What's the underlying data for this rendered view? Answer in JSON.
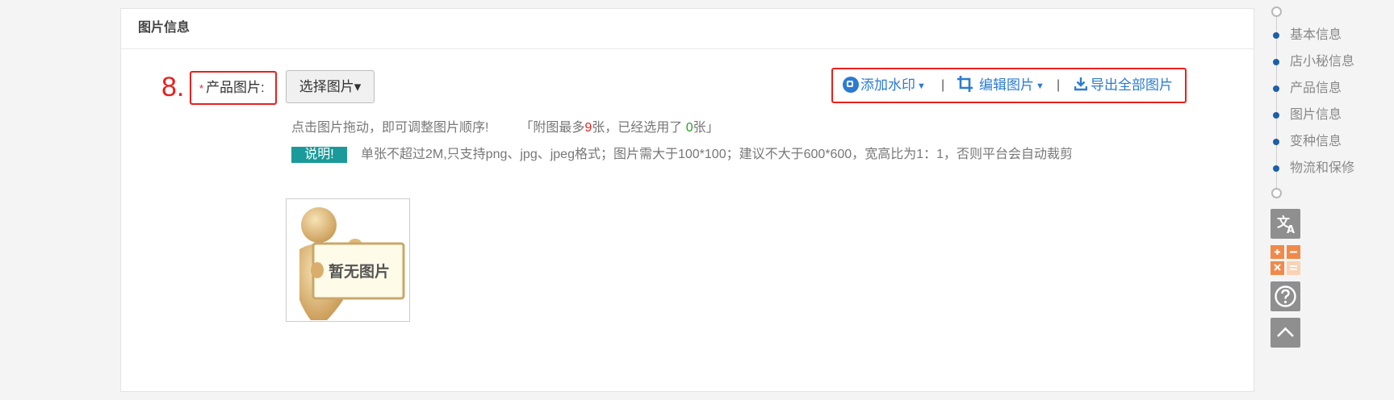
{
  "section": {
    "title": "图片信息"
  },
  "field": {
    "step_number": "8.",
    "required_mark": "*",
    "label": "产品图片:",
    "choose_button": "选择图片▾"
  },
  "toolbar": {
    "watermark_label": "添加水印",
    "edit_label": "编辑图片",
    "export_label": "导出全部图片",
    "separator": "|"
  },
  "hint": {
    "drag_text": "点击图片拖动，即可调整图片顺序!",
    "max_prefix": "「附图最多",
    "max_count": "9",
    "max_middle": "张，已经选用了",
    "selected_count": "0",
    "max_suffix": "张」"
  },
  "note": {
    "badge": "说明!",
    "text": "单张不超过2M,只支持png、jpg、jpeg格式；图片需大于100*100；建议不大于600*600，宽高比为1：1，否则平台会自动裁剪"
  },
  "placeholder": {
    "text": "暂无图片"
  },
  "anchor_nav": {
    "items": [
      "基本信息",
      "店小秘信息",
      "产品信息",
      "图片信息",
      "变种信息",
      "物流和保修"
    ]
  },
  "side_tools": {
    "icons": [
      "translate-icon",
      "calculator-icon",
      "help-icon",
      "back-to-top-icon"
    ]
  },
  "colors": {
    "accent_red": "#e8201d",
    "link_blue": "#2c7bd1",
    "badge_teal": "#1a9a9a",
    "nav_dot": "#1e5fa8",
    "calc_orange": "#f08a4b"
  }
}
